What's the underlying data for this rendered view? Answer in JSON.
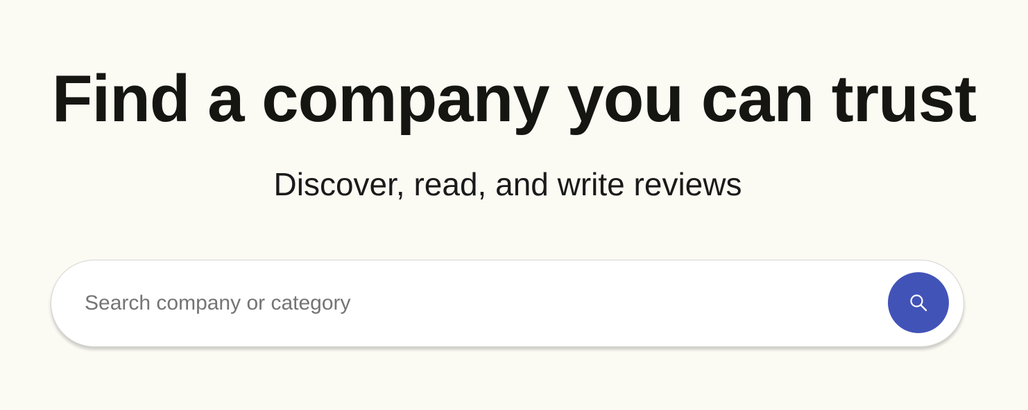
{
  "hero": {
    "title": "Find a company you can trust",
    "subtitle": "Discover, read, and write reviews"
  },
  "search": {
    "placeholder": "Search company or category",
    "value": "",
    "button_icon": "search-icon",
    "button_color": "#4253b8"
  },
  "colors": {
    "background": "#fbfaf3",
    "text": "#151612"
  }
}
